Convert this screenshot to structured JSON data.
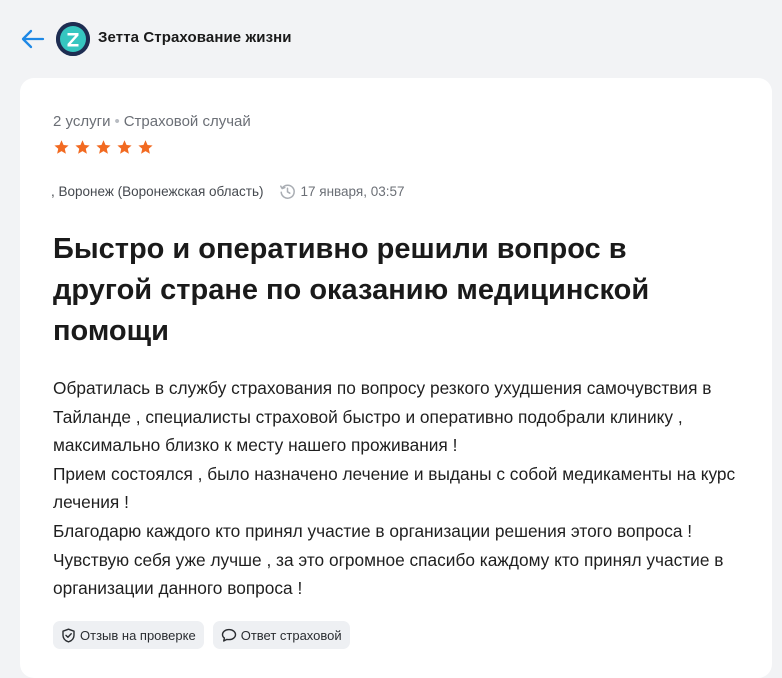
{
  "header": {
    "company_name": "Зетта Страхование жизни",
    "logo_letter": "Z",
    "back_icon": "arrow-left-icon"
  },
  "review": {
    "services_count": "2 услуги",
    "category": "Страховой случай",
    "rating": 5,
    "rating_max": 5,
    "location": ", Воронеж (Воронежская область)",
    "timestamp": "17 января, 03:57",
    "title": "Быстро и оперативно решили вопрос в другой стране по оказанию медицинской помощи",
    "paragraphs": [
      "Обратилась в службу страхования по вопросу резкого ухудшения самочувствия в Тайланде , специалисты страховой быстро и оперативно подобрали клинику , максимально близко к месту нашего проживания !",
      "Прием состоялся , было назначено лечение и выданы с собой медикаменты на курс лечения !",
      "Благодарю каждого кто принял участие в организации решения этого вопроса !",
      "Чувствую себя уже  лучше , за это огромное спасибо каждому кто принял участие в организации данного вопроса !"
    ],
    "badges": {
      "review_status": "Отзыв на проверке",
      "company_reply": "Ответ страховой"
    }
  },
  "colors": {
    "accent": "#1e88e5",
    "star": "#f26a21",
    "logo_bg": "#1e2d52",
    "logo_accent": "#36c6c0",
    "page_bg": "#f2f3f5"
  }
}
